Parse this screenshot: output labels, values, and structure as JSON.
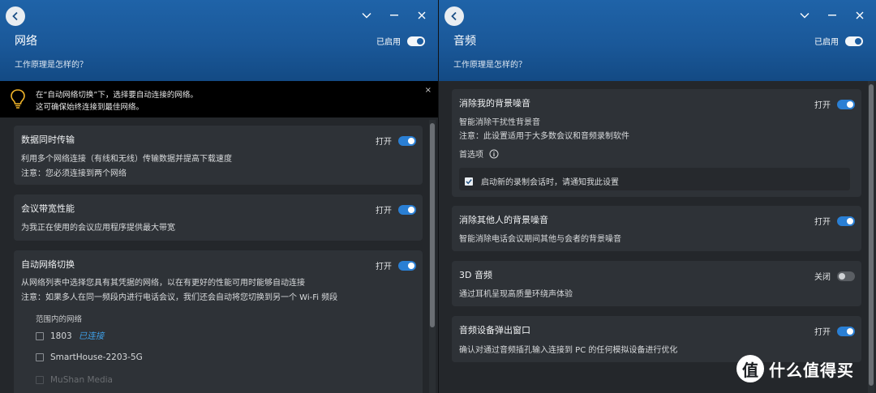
{
  "left": {
    "header": {
      "title": "网络",
      "how": "工作原理是怎样的？",
      "enabled_label": "已启用"
    },
    "notice": {
      "line1": "在“自动网络切换”下，选择要自动连接的网络。",
      "line2": "这可确保始终连接到最佳网络。",
      "close": "×"
    },
    "cards": [
      {
        "title": "数据同时传输",
        "state": "打开",
        "desc1": "利用多个网络连接（有线和无线）传输数据并提高下载速度",
        "desc2": "注意：您必须连接到两个网络"
      },
      {
        "title": "会议带宽性能",
        "state": "打开",
        "desc1": "为我正在使用的会议应用程序提供最大带宽"
      },
      {
        "title": "自动网络切换",
        "state": "打开",
        "desc1": "从网络列表中选择您具有其凭据的网络，以在有更好的性能可用时能够自动连接",
        "desc2": "注意：如果多人在同一频段内进行电话会议，我们还会自动将您切换到另一个 Wi-Fi 频段",
        "range_label": "范围内的网络",
        "networks": [
          {
            "name": "1803",
            "status": "已连接"
          },
          {
            "name": "SmartHouse-2203-5G",
            "status": ""
          },
          {
            "name": "MuShan Media",
            "status": ""
          }
        ]
      }
    ]
  },
  "right": {
    "header": {
      "title": "音频",
      "how": "工作原理是怎样的？",
      "enabled_label": "已启用"
    },
    "cards": [
      {
        "title": "消除我的背景噪音",
        "state": "打开",
        "desc1": "智能消除干扰性背景音",
        "desc2": "注意：此设置适用于大多数会议和音频录制软件",
        "pref_label": "首选项",
        "pref_option": "启动新的录制会话时，请通知我此设置",
        "pref_checked": true
      },
      {
        "title": "消除其他人的背景噪音",
        "state": "打开",
        "desc1": "智能消除电话会议期间其他与会者的背景噪音"
      },
      {
        "title": "3D 音频",
        "state": "关闭",
        "desc1": "通过耳机呈现高质量环绕声体验"
      },
      {
        "title": "音频设备弹出窗口",
        "state": "打开",
        "desc1": "确认对通过音频插孔输入连接到 PC 的任何模拟设备进行优化"
      }
    ]
  },
  "watermark": {
    "logo": "值",
    "text": "什么值得买"
  },
  "colors": {
    "header_blue": "#1a5899",
    "toggle_on": "#2a7fd4",
    "link_blue": "#3fa0e8",
    "card_bg": "#2e3237"
  }
}
